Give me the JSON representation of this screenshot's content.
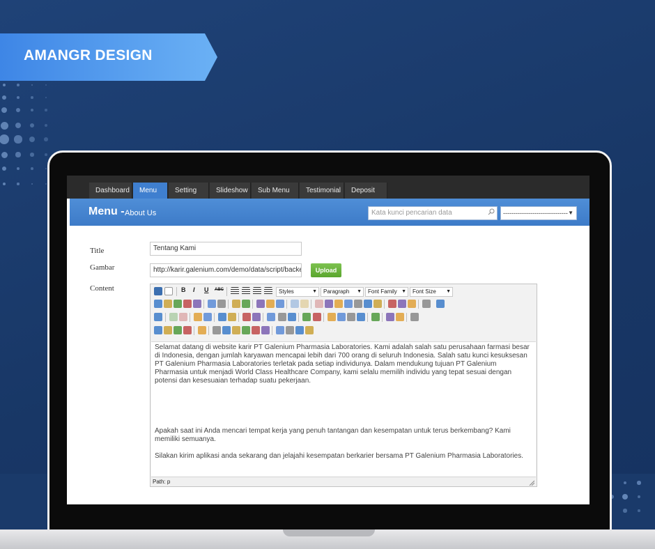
{
  "brand": {
    "title": "AMANGR DESIGN",
    "color": "#5aa1f0"
  },
  "nav": {
    "items": [
      {
        "label": "Dashboard",
        "caret": ""
      },
      {
        "label": "Menu",
        "caret": "▼",
        "active": true
      },
      {
        "label": "Setting",
        "caret": "▼"
      },
      {
        "label": "Slideshow",
        "caret": ""
      },
      {
        "label": "Sub Menu",
        "caret": "▼"
      },
      {
        "label": "Testimonial",
        "caret": ""
      },
      {
        "label": "Deposit",
        "caret": "▼"
      }
    ]
  },
  "header": {
    "title": "Menu -",
    "subtitle": "About Us",
    "search_placeholder": "Kata kunci pencarian data",
    "select_value": "-------------------------------"
  },
  "form": {
    "title_label": "Title",
    "title_value": "Tentang Kami",
    "image_label": "Gambar",
    "image_value": "http://karir.galenium.com/demo/data/script/backer",
    "upload_label": "Upload",
    "content_label": "Content"
  },
  "editor": {
    "dropdowns": {
      "styles": "Styles",
      "paragraph": "Paragraph",
      "font_family": "Font Family",
      "font_size": "Font Size"
    },
    "toolbar_text": {
      "bold": "B",
      "italic": "I",
      "underline": "U",
      "strike": "ABC"
    },
    "paragraphs": [
      "Selamat datang di website karir PT Galenium Pharmasia Laboratories. Kami adalah salah satu perusahaan farmasi besar di Indonesia, dengan jumlah karyawan mencapai lebih dari 700 orang di seluruh Indonesia. Salah satu kunci kesuksesan PT Galenium Pharmasia Laboratories terletak pada setiap individunya. Dalam mendukung tujuan PT Galenium Pharmasia untuk menjadi World Class Healthcare Company, kami selalu memilih individu yang tepat sesuai dengan potensi dan kesesuaian terhadap suatu pekerjaan.",
      "Apakah saat ini Anda mencari tempat kerja yang penuh tantangan dan kesempatan untuk terus berkembang? Kami memiliki semuanya.",
      "Silakan kirim aplikasi anda sekarang dan jelajahi kesempatan berkarier bersama PT Galenium Pharmasia Laboratories."
    ],
    "path": "Path: p"
  },
  "colors": {
    "accent": "#3f7fcf",
    "background": "#1c3c6e",
    "upload": "#5aa62d"
  }
}
